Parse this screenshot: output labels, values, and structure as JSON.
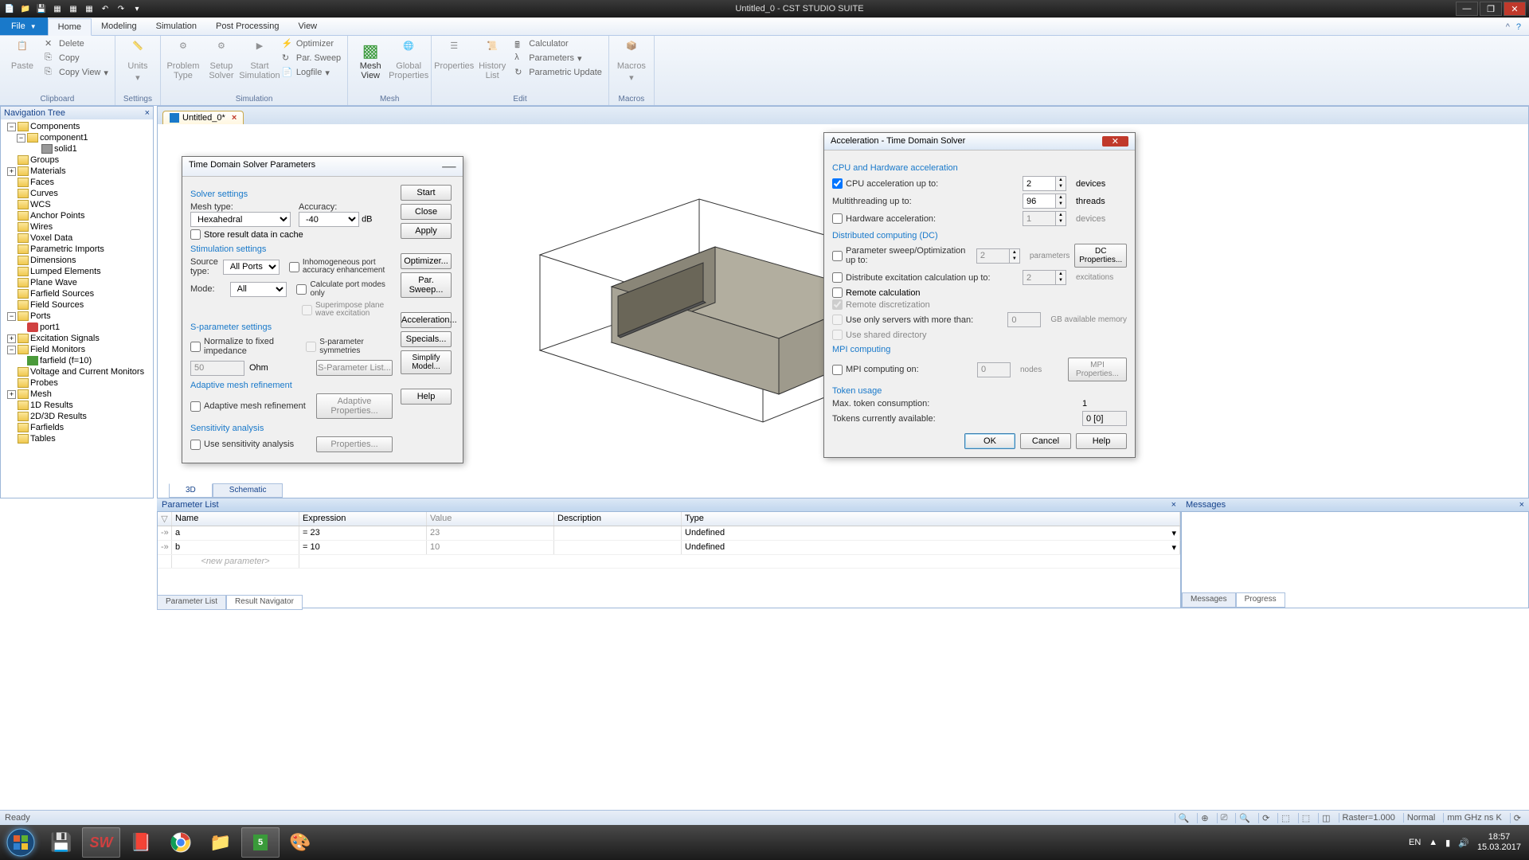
{
  "titlebar": {
    "title": "Untitled_0 - CST STUDIO SUITE"
  },
  "ribbon_tabs": {
    "file": "File",
    "home": "Home",
    "modeling": "Modeling",
    "simulation": "Simulation",
    "post": "Post Processing",
    "view": "View"
  },
  "ribbon": {
    "clipboard": {
      "label": "Clipboard",
      "paste": "Paste",
      "delete": "Delete",
      "copy": "Copy",
      "copyview": "Copy View"
    },
    "settings": {
      "label": "Settings",
      "units": "Units"
    },
    "simulation": {
      "label": "Simulation",
      "problem": "Problem\nType",
      "setup": "Setup\nSolver",
      "start": "Start\nSimulation",
      "optimizer": "Optimizer",
      "par_sweep": "Par. Sweep",
      "logfile": "Logfile"
    },
    "mesh": {
      "label": "Mesh",
      "mesh_view": "Mesh\nView",
      "global": "Global\nProperties"
    },
    "edit": {
      "label": "Edit",
      "properties": "Properties",
      "history": "History\nList",
      "calculator": "Calculator",
      "parameters": "Parameters",
      "param_update": "Parametric Update"
    },
    "macros": {
      "label": "Macros",
      "macros": "Macros"
    }
  },
  "nav_tree": {
    "title": "Navigation Tree",
    "items": [
      "Components",
      "component1",
      "solid1",
      "Groups",
      "Materials",
      "Faces",
      "Curves",
      "WCS",
      "Anchor Points",
      "Wires",
      "Voxel Data",
      "Parametric Imports",
      "Dimensions",
      "Lumped Elements",
      "Plane Wave",
      "Farfield Sources",
      "Field Sources",
      "Ports",
      "port1",
      "Excitation Signals",
      "Field Monitors",
      "farfield (f=10)",
      "Voltage and Current Monitors",
      "Probes",
      "Mesh",
      "1D Results",
      "2D/3D Results",
      "Farfields",
      "Tables"
    ]
  },
  "doc_tab": {
    "label": "Untitled_0*"
  },
  "view_tabs": {
    "t3d": "3D",
    "schematic": "Schematic"
  },
  "param_list": {
    "title": "Parameter List",
    "cols": {
      "name": "Name",
      "expr": "Expression",
      "value": "Value",
      "desc": "Description",
      "type": "Type"
    },
    "rows": [
      {
        "name": "a",
        "expr": "23",
        "value": "23",
        "type": "Undefined"
      },
      {
        "name": "b",
        "expr": "10",
        "value": "10",
        "type": "Undefined"
      }
    ],
    "new": "<new parameter>",
    "tab_param": "Parameter List",
    "tab_result": "Result Navigator"
  },
  "messages": {
    "title": "Messages",
    "tab_msg": "Messages",
    "tab_prog": "Progress"
  },
  "status": {
    "ready": "Ready",
    "raster": "Raster=1.000",
    "normal": "Normal",
    "units": "mm  GHz  ns  K"
  },
  "solver_dialog": {
    "title": "Time Domain Solver Parameters",
    "s_solver": "Solver settings",
    "mesh_type": "Mesh type:",
    "mesh_type_val": "Hexahedral",
    "accuracy": "Accuracy:",
    "accuracy_val": "-40",
    "accuracy_unit": "dB",
    "store_cache": "Store result data in cache",
    "s_stim": "Stimulation settings",
    "source_type": "Source type:",
    "source_type_val": "All Ports",
    "inhom": "Inhomogeneous port accuracy enhancement",
    "mode": "Mode:",
    "mode_val": "All",
    "calc_port": "Calculate port modes only",
    "superimpose": "Superimpose plane wave excitation",
    "s_sparam": "S-parameter settings",
    "normalize": "Normalize to fixed impedance",
    "sparam_sym": "S-parameter symmetries",
    "ohm_val": "50",
    "ohm": "Ohm",
    "sparam_list": "S-Parameter List...",
    "s_adaptive": "Adaptive mesh refinement",
    "adaptive": "Adaptive mesh refinement",
    "adaptive_props": "Adaptive Properties...",
    "s_sens": "Sensitivity analysis",
    "use_sens": "Use sensitivity analysis",
    "props": "Properties...",
    "btn_start": "Start",
    "btn_close": "Close",
    "btn_apply": "Apply",
    "btn_optimizer": "Optimizer...",
    "btn_parsweep": "Par. Sweep...",
    "btn_accel": "Acceleration...",
    "btn_specials": "Specials...",
    "btn_simplify": "Simplify Model...",
    "btn_help": "Help"
  },
  "accel_dialog": {
    "title": "Acceleration - Time Domain Solver",
    "s_cpu": "CPU and Hardware acceleration",
    "cpu_accel": "CPU acceleration up to:",
    "cpu_val": "2",
    "devices": "devices",
    "multi": "Multithreading up to:",
    "multi_val": "96",
    "threads": "threads",
    "hw_accel": "Hardware acceleration:",
    "hw_val": "1",
    "s_dc": "Distributed computing (DC)",
    "param_sweep": "Parameter sweep/Optimization up to:",
    "param_val": "2",
    "parameters": "parameters",
    "dc_props": "DC Properties...",
    "dist_exc": "Distribute excitation calculation up to:",
    "dist_val": "2",
    "excitations": "excitations",
    "remote_calc": "Remote calculation",
    "remote_disc": "Remote discretization",
    "use_servers": "Use only servers with more than:",
    "use_servers_val": "0",
    "gb": "GB available memory",
    "use_shared": "Use shared directory",
    "s_mpi": "MPI computing",
    "mpi_on": "MPI computing on:",
    "mpi_val": "0",
    "nodes": "nodes",
    "mpi_props": "MPI Properties...",
    "s_token": "Token usage",
    "max_token": "Max. token consumption:",
    "max_token_val": "1",
    "avail": "Tokens currently available:",
    "avail_val": "0 [0]",
    "btn_ok": "OK",
    "btn_cancel": "Cancel",
    "btn_help": "Help"
  },
  "taskbar": {
    "lang": "EN",
    "time": "18:57",
    "date": "15.03.2017"
  }
}
